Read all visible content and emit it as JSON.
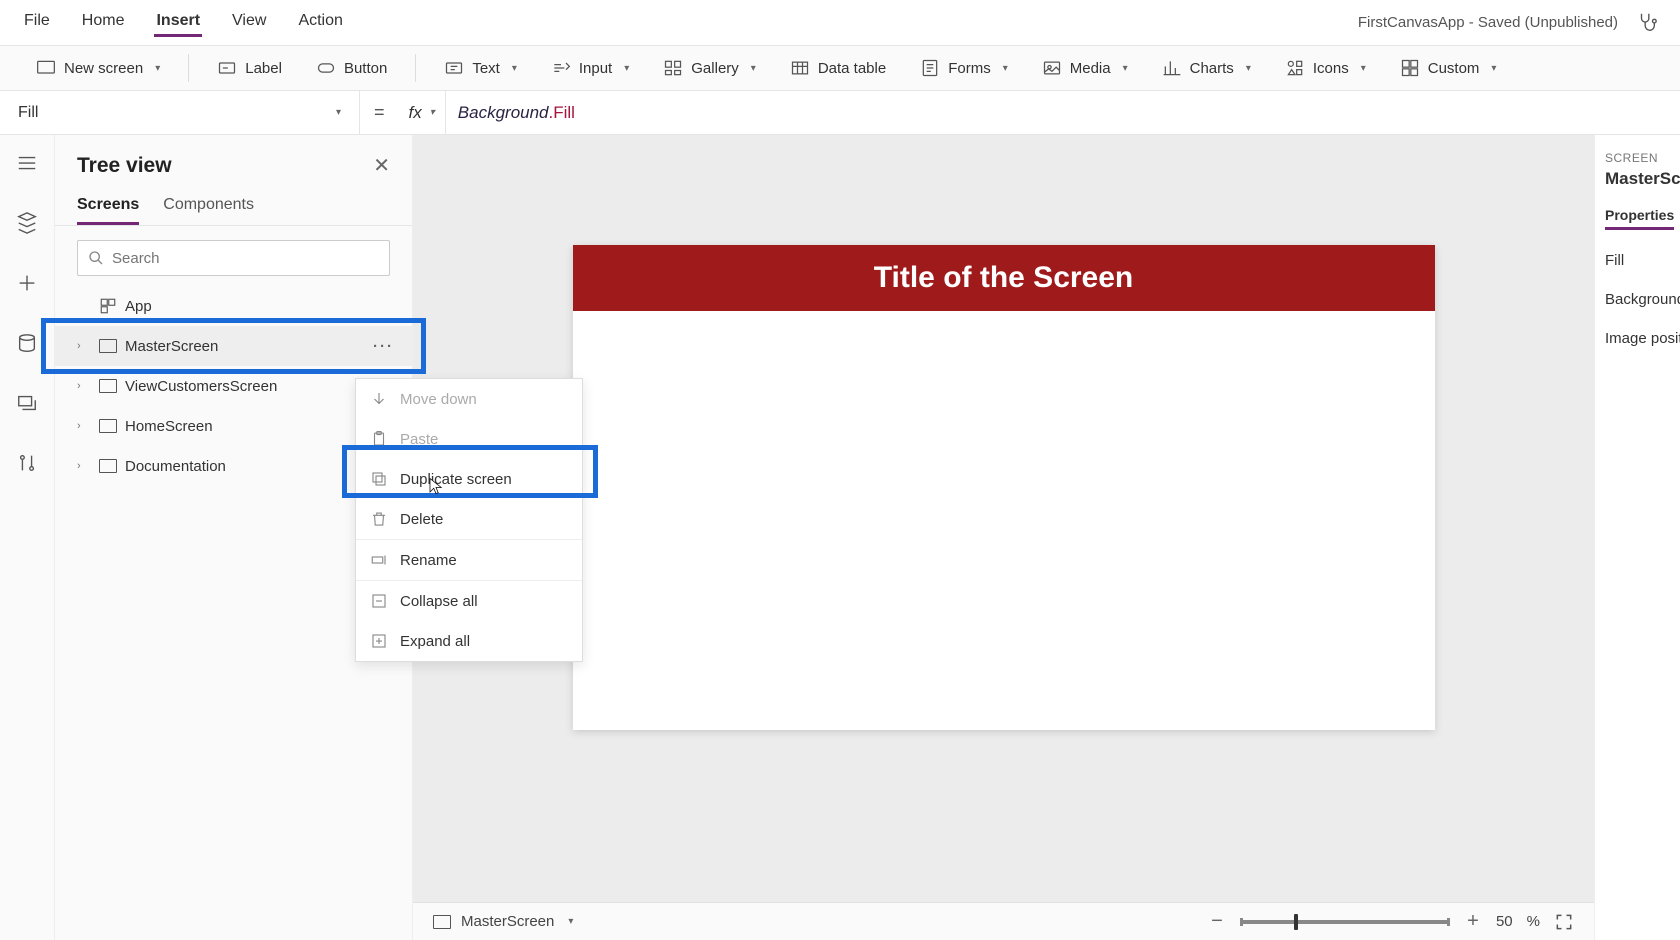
{
  "menu": {
    "file": "File",
    "home": "Home",
    "insert": "Insert",
    "view": "View",
    "action": "Action"
  },
  "title": "FirstCanvasApp - Saved (Unpublished)",
  "ribbon": {
    "new_screen": "New screen",
    "label": "Label",
    "button": "Button",
    "text": "Text",
    "input": "Input",
    "gallery": "Gallery",
    "data_table": "Data table",
    "forms": "Forms",
    "media": "Media",
    "charts": "Charts",
    "icons": "Icons",
    "custom": "Custom"
  },
  "formula": {
    "property": "Fill",
    "object": "Background",
    "member": ".Fill"
  },
  "tree": {
    "title": "Tree view",
    "tabs": {
      "screens": "Screens",
      "components": "Components"
    },
    "search_placeholder": "Search",
    "nodes": {
      "app": "App",
      "master": "MasterScreen",
      "view_customers": "ViewCustomersScreen",
      "home": "HomeScreen",
      "documentation": "Documentation"
    }
  },
  "context": {
    "move_down": "Move down",
    "paste": "Paste",
    "duplicate": "Duplicate screen",
    "delete": "Delete",
    "rename": "Rename",
    "collapse": "Collapse all",
    "expand": "Expand all"
  },
  "canvas": {
    "screen_title": "Title of the Screen"
  },
  "status": {
    "screen_name": "MasterScreen",
    "zoom": "50",
    "zoom_pct": "%"
  },
  "props": {
    "label": "SCREEN",
    "name": "MasterScreen",
    "tab": "Properties",
    "fill": "Fill",
    "bg_image": "Background image",
    "img_pos": "Image position"
  }
}
